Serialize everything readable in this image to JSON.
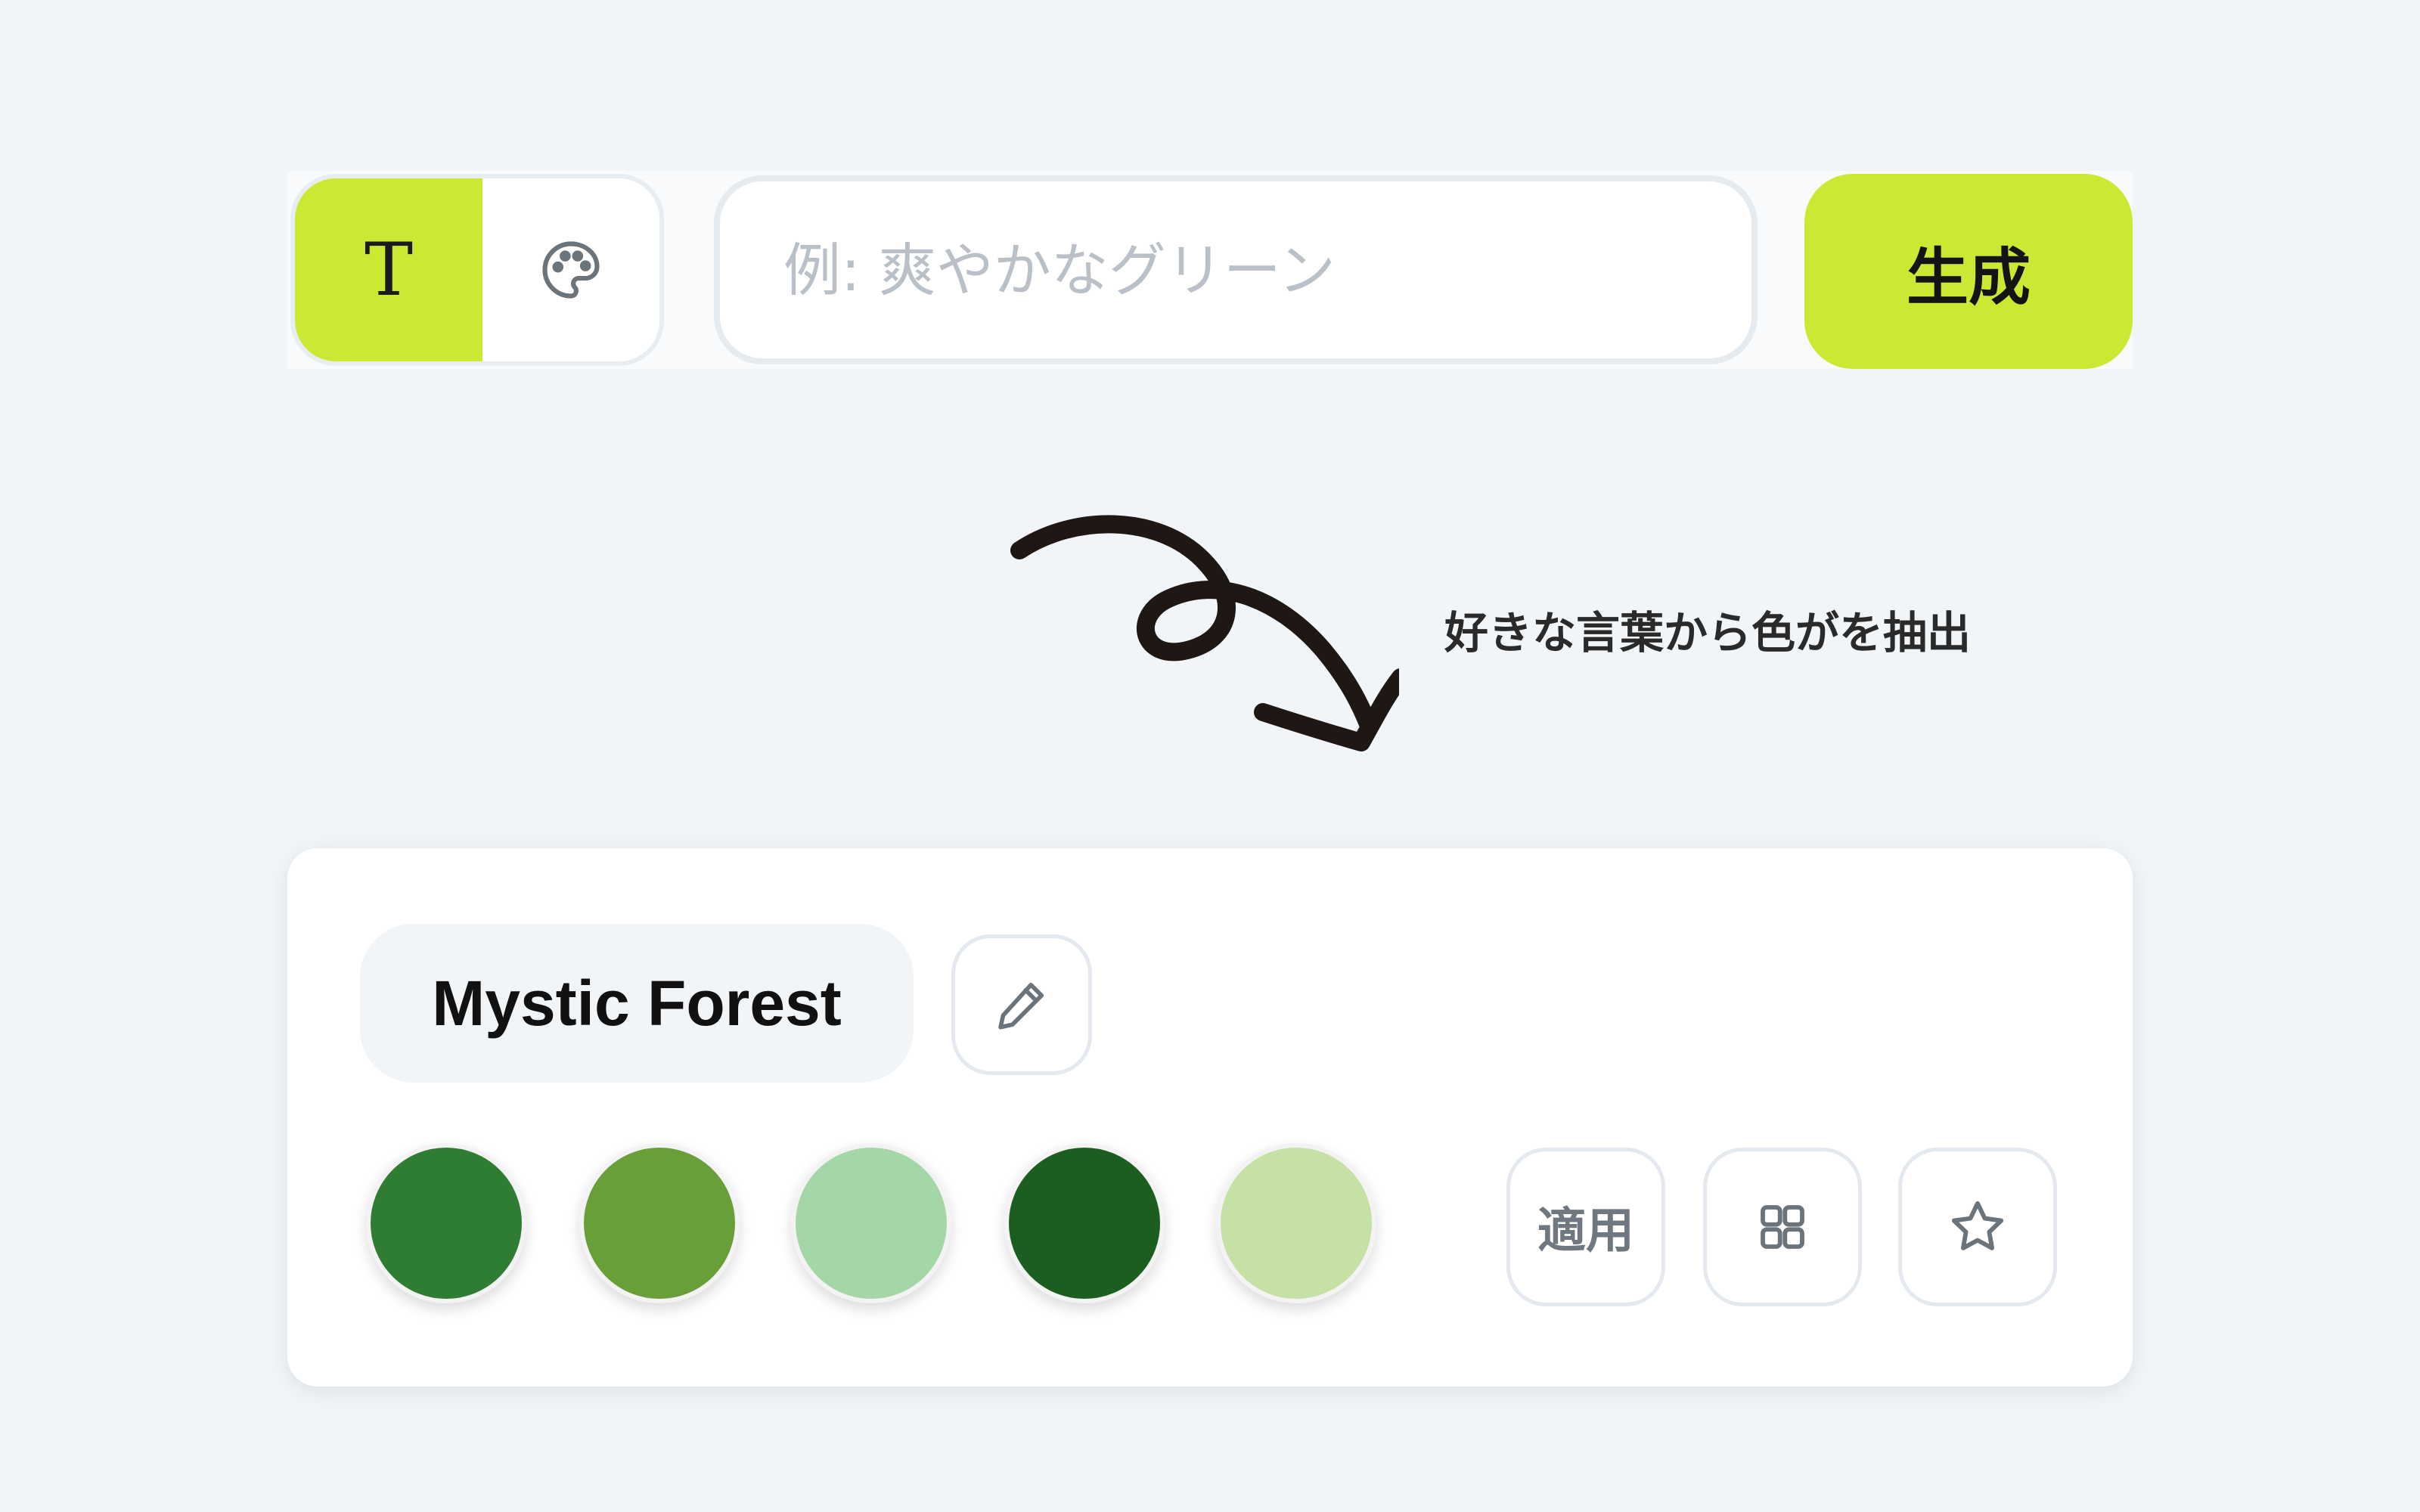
{
  "generator": {
    "modes": [
      {
        "id": "text",
        "icon": "text-t-icon",
        "label": "T",
        "active": true
      },
      {
        "id": "palette",
        "icon": "palette-icon",
        "active": false
      }
    ],
    "input": {
      "value": "",
      "placeholder": "例: 爽やかなグリーン"
    },
    "generate_label": "生成",
    "accent_color": "#cbe833"
  },
  "caption": "好きな言葉から色がを抽出",
  "result": {
    "palette_name": "Mystic Forest",
    "edit_icon": "pencil-icon",
    "swatches": [
      {
        "color": "#2e7d32"
      },
      {
        "color": "#689f38"
      },
      {
        "color": "#a5d6a7"
      },
      {
        "color": "#1b5e20"
      },
      {
        "color": "#c5e1a5"
      }
    ],
    "actions": {
      "apply_label": "適用",
      "grid_icon": "grid-icon",
      "favorite_icon": "star-icon"
    }
  }
}
